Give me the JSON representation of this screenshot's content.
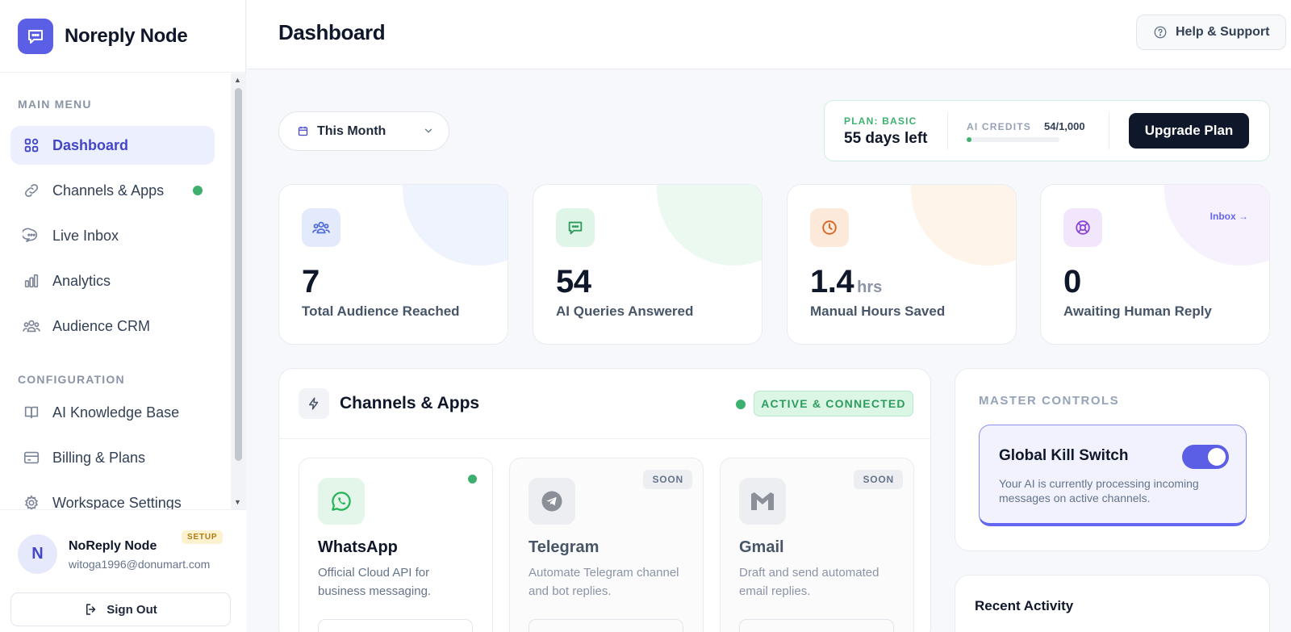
{
  "brand": {
    "name": "Noreply Node"
  },
  "sidebar": {
    "main_menu_label": "MAIN MENU",
    "config_label": "CONFIGURATION",
    "main_items": [
      {
        "label": "Dashboard",
        "icon": "grid-icon",
        "active": true
      },
      {
        "label": "Channels & Apps",
        "icon": "link-icon",
        "status_dot": true
      },
      {
        "label": "Live Inbox",
        "icon": "chat-icon"
      },
      {
        "label": "Analytics",
        "icon": "bar-chart-icon"
      },
      {
        "label": "Audience CRM",
        "icon": "users-icon"
      }
    ],
    "config_items": [
      {
        "label": "AI Knowledge Base",
        "icon": "book-icon"
      },
      {
        "label": "Billing & Plans",
        "icon": "credit-card-icon"
      },
      {
        "label": "Workspace Settings",
        "icon": "gear-icon"
      }
    ]
  },
  "user": {
    "initial": "N",
    "name": "NoReply Node",
    "email": "witoga1996@donumart.com",
    "badge": "SETUP",
    "sign_out": "Sign Out"
  },
  "header": {
    "title": "Dashboard",
    "help": "Help & Support"
  },
  "filters": {
    "period": "This Month"
  },
  "plan": {
    "label": "PLAN: BASIC",
    "days_left": "55 days left",
    "credits_label": "AI CREDITS",
    "credits_value": "54/1,000",
    "credits_used_fraction": 0.054,
    "upgrade": "Upgrade Plan"
  },
  "stats": [
    {
      "value": "7",
      "unit": "",
      "label": "Total Audience Reached",
      "icon": "users-icon",
      "color": "#4f6bd8",
      "bg": "#e3eafb",
      "blob": "#eef3fd"
    },
    {
      "value": "54",
      "unit": "",
      "label": "AI Queries Answered",
      "icon": "chat-icon",
      "color": "#2d9b5c",
      "bg": "#dff5e8",
      "blob": "#ecf9f1"
    },
    {
      "value": "1.4",
      "unit": "hrs",
      "label": "Manual Hours Saved",
      "icon": "clock-icon",
      "color": "#d9601f",
      "bg": "#fde9d9",
      "blob": "#fef4ea"
    },
    {
      "value": "0",
      "unit": "",
      "label": "Awaiting Human Reply",
      "icon": "lifebuoy-icon",
      "color": "#8a46d6",
      "bg": "#f1e6fb",
      "blob": "#f7f1fd",
      "link": "Inbox →"
    }
  ],
  "channels": {
    "title": "Channels & Apps",
    "status": "ACTIVE & CONNECTED",
    "items": [
      {
        "name": "WhatsApp",
        "desc": "Official Cloud API for business messaging.",
        "icon": "whatsapp-icon",
        "color": "#25b35a",
        "active": true
      },
      {
        "name": "Telegram",
        "desc": "Automate Telegram channel and bot replies.",
        "icon": "telegram-icon",
        "color": "#8a8f98",
        "badge": "SOON"
      },
      {
        "name": "Gmail",
        "desc": "Draft and send automated email replies.",
        "icon": "gmail-icon",
        "color": "#8a8f98",
        "badge": "SOON"
      }
    ]
  },
  "master": {
    "title": "MASTER CONTROLS",
    "kill_title": "Global Kill Switch",
    "kill_desc": "Your AI is currently processing incoming messages on active channels.",
    "enabled": true
  },
  "recent": {
    "title": "Recent Activity"
  },
  "colors": {
    "accent": "#5b5fe6",
    "success": "#3db06f",
    "dark": "#0f172a"
  }
}
